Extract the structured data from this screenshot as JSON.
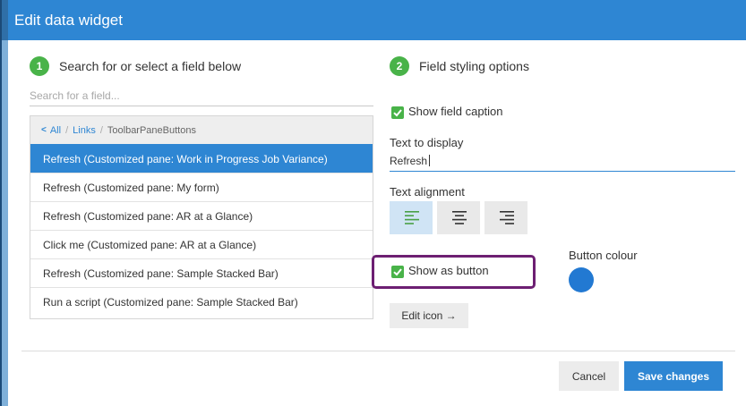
{
  "dialog": {
    "title": "Edit data widget"
  },
  "left_panel": {
    "step_number": "1",
    "heading": "Search for or select a field below",
    "search_placeholder": "Search for a field...",
    "breadcrumb": {
      "chevron": "<",
      "all": "All",
      "links": "Links",
      "current": "ToolbarPaneButtons",
      "separator": "/"
    },
    "items": [
      {
        "label": "Refresh (Customized pane: Work in Progress Job Variance)",
        "selected": true
      },
      {
        "label": "Refresh (Customized pane: My form)",
        "selected": false
      },
      {
        "label": "Refresh (Customized pane: AR at a Glance)",
        "selected": false
      },
      {
        "label": "Click me (Customized pane: AR at a Glance)",
        "selected": false
      },
      {
        "label": "Refresh (Customized pane: Sample Stacked Bar)",
        "selected": false
      },
      {
        "label": "Run a script (Customized pane: Sample Stacked Bar)",
        "selected": false
      }
    ]
  },
  "right_panel": {
    "step_number": "2",
    "heading": "Field styling options",
    "show_field_caption": {
      "label": "Show field caption",
      "checked": true
    },
    "text_to_display": {
      "label": "Text to display",
      "value": "Refresh"
    },
    "text_alignment": {
      "label": "Text alignment",
      "options": [
        {
          "name": "align-left-icon",
          "active": true
        },
        {
          "name": "align-center-icon",
          "active": false
        },
        {
          "name": "align-right-icon",
          "active": false
        }
      ]
    },
    "show_as_button": {
      "label": "Show as button",
      "checked": true
    },
    "button_colour": {
      "label": "Button colour",
      "value": "#2279d2"
    },
    "edit_icon": {
      "label": "Edit icon →"
    }
  },
  "footer": {
    "cancel_label": "Cancel",
    "save_label": "Save changes"
  },
  "colors": {
    "accent": "#2e86d3",
    "check": "#49b349",
    "highlight": "#6d1f72"
  }
}
